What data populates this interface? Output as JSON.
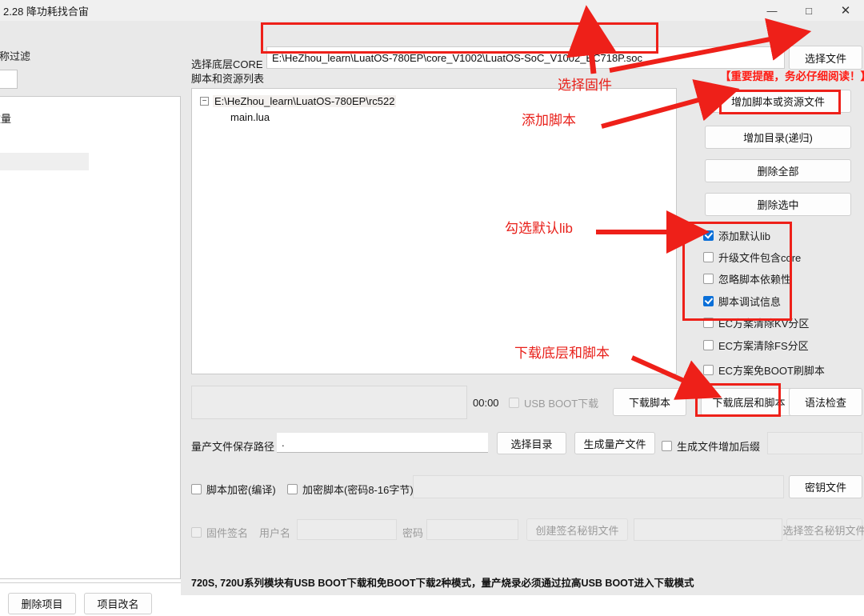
{
  "window": {
    "title": "2.28 降功耗找合宙",
    "controls": {
      "minimize": "—",
      "maximize": "□",
      "close": "✕"
    }
  },
  "left_panel": {
    "filter_label": "名称过滤",
    "filter_value": "",
    "count_label": "数量",
    "delete_project_button": "删除项目",
    "rename_project_button": "项目改名"
  },
  "main": {
    "core_label": "选择底层CORE",
    "core_path": "E:\\HeZhou_learn\\LuatOS-780EP\\core_V1002\\LuatOS-SoC_V1002_EC718P.soc",
    "choose_file_button": "选择文件",
    "script_list_label": "脚本和资源列表",
    "tree": {
      "expander": "−",
      "root": "E:\\HeZhou_learn\\LuatOS-780EP\\rc522",
      "children": [
        "main.lua"
      ]
    },
    "side_buttons": [
      "增加脚本或资源文件",
      "增加目录(递归)",
      "删除全部",
      "删除选中"
    ],
    "options": [
      {
        "label": "添加默认lib",
        "checked": true,
        "disabled": false
      },
      {
        "label": "升级文件包含core",
        "checked": false,
        "disabled": false
      },
      {
        "label": "忽略脚本依赖性",
        "checked": false,
        "disabled": false
      },
      {
        "label": "脚本调试信息",
        "checked": true,
        "disabled": false
      },
      {
        "label": "EC方案清除KV分区",
        "checked": false,
        "disabled": false
      },
      {
        "label": "EC方案清除FS分区",
        "checked": false,
        "disabled": false
      },
      {
        "label": "EC方案免BOOT刷脚本",
        "checked": false,
        "disabled": false
      }
    ],
    "timer": "00:00",
    "usb_boot_label": "USB BOOT下载",
    "usb_boot_checked": false,
    "download_script_button": "下载脚本",
    "download_core_script_button": "下载底层和脚本",
    "syntax_check_button": "语法检查",
    "massprod_path_label": "量产文件保存路径",
    "massprod_path_value": ".",
    "choose_dir_button": "选择目录",
    "gen_massprod_button": "生成量产文件",
    "add_suffix_label": "生成文件增加后缀",
    "add_suffix_checked": false,
    "suffix_value": "",
    "script_encrypt_label": "脚本加密(编译)",
    "script_encrypt_checked": false,
    "encrypt_script_label": "加密脚本(密码8-16字节)",
    "encrypt_script_checked": false,
    "encrypt_password_value": "",
    "key_file_button": "密钥文件",
    "firmware_sign_label": "固件签名",
    "firmware_sign_checked": false,
    "username_label": "用户名",
    "username_value": "",
    "password_label": "密码",
    "password_value": "",
    "create_sign_key_button": "创建签名秘钥文件",
    "sign_key_path_value": "",
    "choose_sign_key_button": "选择签名秘钥文件",
    "bottom_hint": "720S, 720U系列模块有USB BOOT下载和免BOOT下载2种模式，量产烧录必须通过拉高USB BOOT进入下载模式"
  },
  "annotations": {
    "warning": "【重要提醒，务必仔细阅读！】",
    "select_firmware": "选择固件",
    "add_script": "添加脚本",
    "check_default_lib": "勾选默认lib",
    "download_core_and_script": "下载底层和脚本",
    "accent_color": "#ee2019"
  }
}
